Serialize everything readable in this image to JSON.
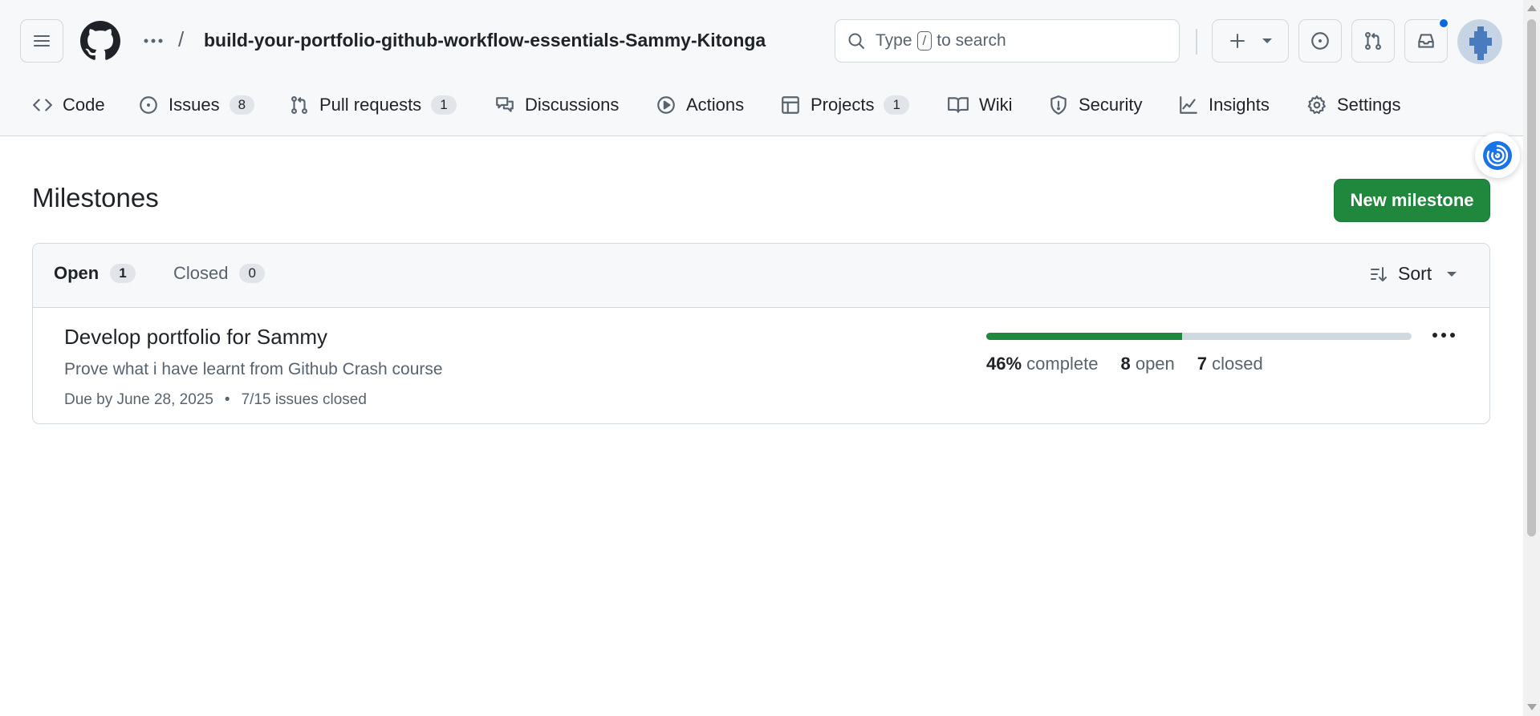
{
  "header": {
    "repo_name": "build-your-portfolio-github-workflow-essentials-Sammy-Kitonga",
    "breadcrumb_separator": "/",
    "search": {
      "prefix": "Type",
      "key": "/",
      "suffix": "to search"
    },
    "has_unread_notifications": true
  },
  "tabs": [
    {
      "label": "Code",
      "icon": "code-icon"
    },
    {
      "label": "Issues",
      "icon": "issue-opened-icon",
      "count": "8"
    },
    {
      "label": "Pull requests",
      "icon": "git-pull-request-icon",
      "count": "1"
    },
    {
      "label": "Discussions",
      "icon": "comment-discussion-icon"
    },
    {
      "label": "Actions",
      "icon": "play-icon"
    },
    {
      "label": "Projects",
      "icon": "table-icon",
      "count": "1"
    },
    {
      "label": "Wiki",
      "icon": "book-icon"
    },
    {
      "label": "Security",
      "icon": "shield-icon"
    },
    {
      "label": "Insights",
      "icon": "graph-icon"
    },
    {
      "label": "Settings",
      "icon": "gear-icon"
    }
  ],
  "page": {
    "title": "Milestones",
    "new_button": "New milestone"
  },
  "filter": {
    "open_label": "Open",
    "open_count": "1",
    "closed_label": "Closed",
    "closed_count": "0",
    "sort_label": "Sort"
  },
  "milestones": [
    {
      "title": "Develop portfolio for Sammy",
      "description": "Prove what i have learnt from Github Crash course",
      "due": "Due by June 28, 2025",
      "separator": "•",
      "issues_closed": "7/15 issues closed",
      "progress_percent": 46,
      "percent_text": "46%",
      "complete_label": "complete",
      "open_count": "8",
      "open_label": "open",
      "closed_count": "7",
      "closed_label": "closed"
    }
  ],
  "colors": {
    "primary_button": "#1f883d",
    "progress_fill": "#1f883d",
    "progress_track": "#d1d9e0",
    "notification_dot": "#0969da",
    "header_bg": "#f6f8fa"
  }
}
